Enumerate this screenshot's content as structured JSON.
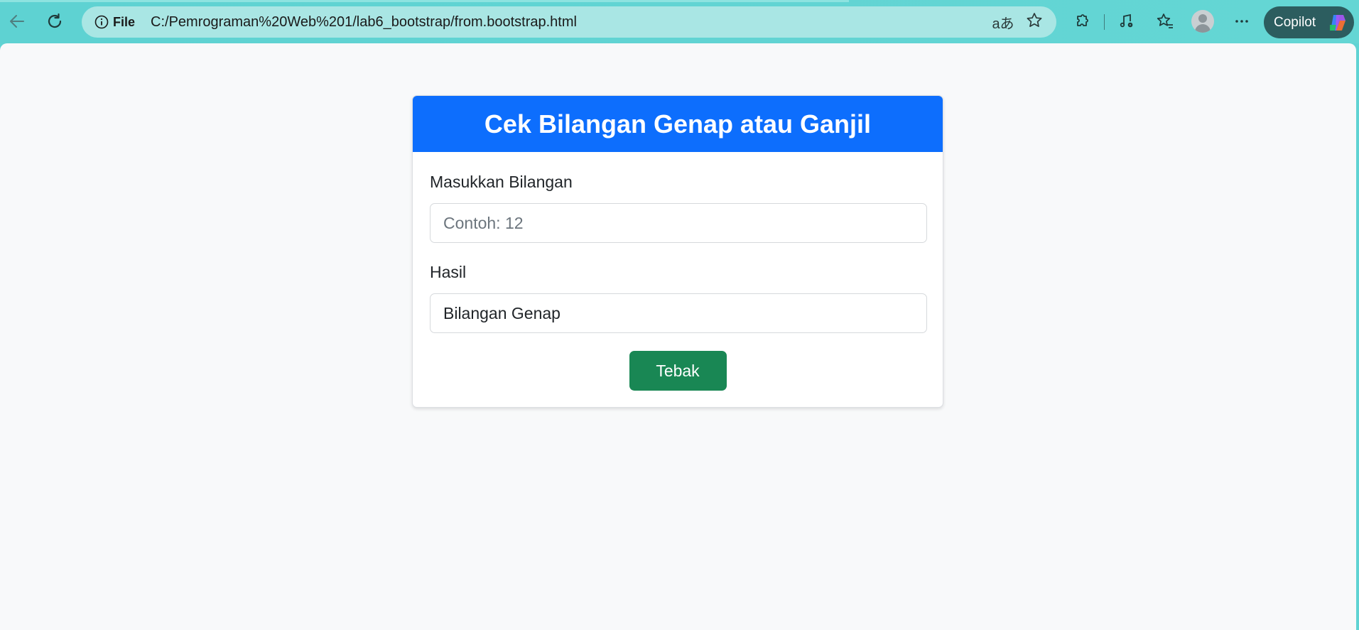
{
  "browser": {
    "site_info_label": "File",
    "url": "C:/Pemrograman%20Web%201/lab6_bootstrap/from.bootstrap.html",
    "copilot_label": "Copilot",
    "icons": [
      "back-arrow-icon",
      "reload-icon",
      "info-icon",
      "read-aloud-icon",
      "favorite-star-icon",
      "extensions-icon",
      "media-icon",
      "favorites-icon",
      "profile-icon",
      "more-icon",
      "copilot-icon"
    ],
    "theme_color": "#5fd3d3"
  },
  "card": {
    "title": "Cek Bilangan Genap atau Ganjil",
    "input_label": "Masukkan Bilangan",
    "input_placeholder": "Contoh: 12",
    "input_value": "",
    "result_label": "Hasil",
    "result_value": "Bilangan Genap",
    "button_label": "Tebak",
    "header_color": "#0d6efd",
    "button_color": "#198754"
  }
}
